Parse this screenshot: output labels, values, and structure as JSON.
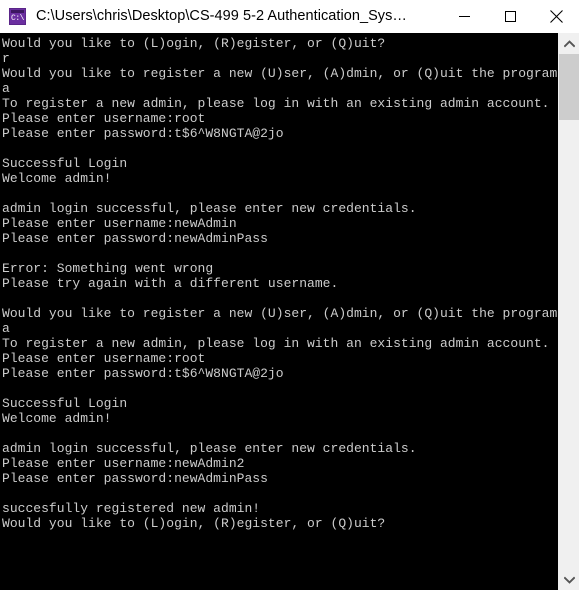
{
  "window": {
    "title": "C:\\Users\\chris\\Desktop\\CS-499 5-2 Authentication_Sys…",
    "icon_name": "cmd-console-icon",
    "icon_glyph": "C:\\",
    "background_color": "#000000",
    "titlebar_color": "#ffffff",
    "text_color": "#cccccc"
  },
  "titlebar_buttons": {
    "minimize_label": "Minimize",
    "maximize_label": "Maximize",
    "close_label": "Close"
  },
  "scrollbar": {
    "up_arrow_label": "Scroll up",
    "down_arrow_label": "Scroll down",
    "thumb_label": "Scroll thumb"
  },
  "console": {
    "lines": [
      "Would you like to (L)ogin, (R)egister, or (Q)uit?",
      "r",
      "Would you like to register a new (U)ser, (A)dmin, or (Q)uit the program?",
      "a",
      "To register a new admin, please log in with an existing admin account.",
      "Please enter username:root",
      "Please enter password:t$6^W8NGTA@2jo",
      "",
      "Successful Login",
      "Welcome admin!",
      "",
      "admin login successful, please enter new credentials.",
      "Please enter username:newAdmin",
      "Please enter password:newAdminPass",
      "",
      "Error: Something went wrong",
      "Please try again with a different username.",
      "",
      "Would you like to register a new (U)ser, (A)dmin, or (Q)uit the program?",
      "a",
      "To register a new admin, please log in with an existing admin account.",
      "Please enter username:root",
      "Please enter password:t$6^W8NGTA@2jo",
      "",
      "Successful Login",
      "Welcome admin!",
      "",
      "admin login successful, please enter new credentials.",
      "Please enter username:newAdmin2",
      "Please enter password:newAdminPass",
      "",
      "succesfully registered new admin!",
      "Would you like to (L)ogin, (R)egister, or (Q)uit?"
    ]
  }
}
